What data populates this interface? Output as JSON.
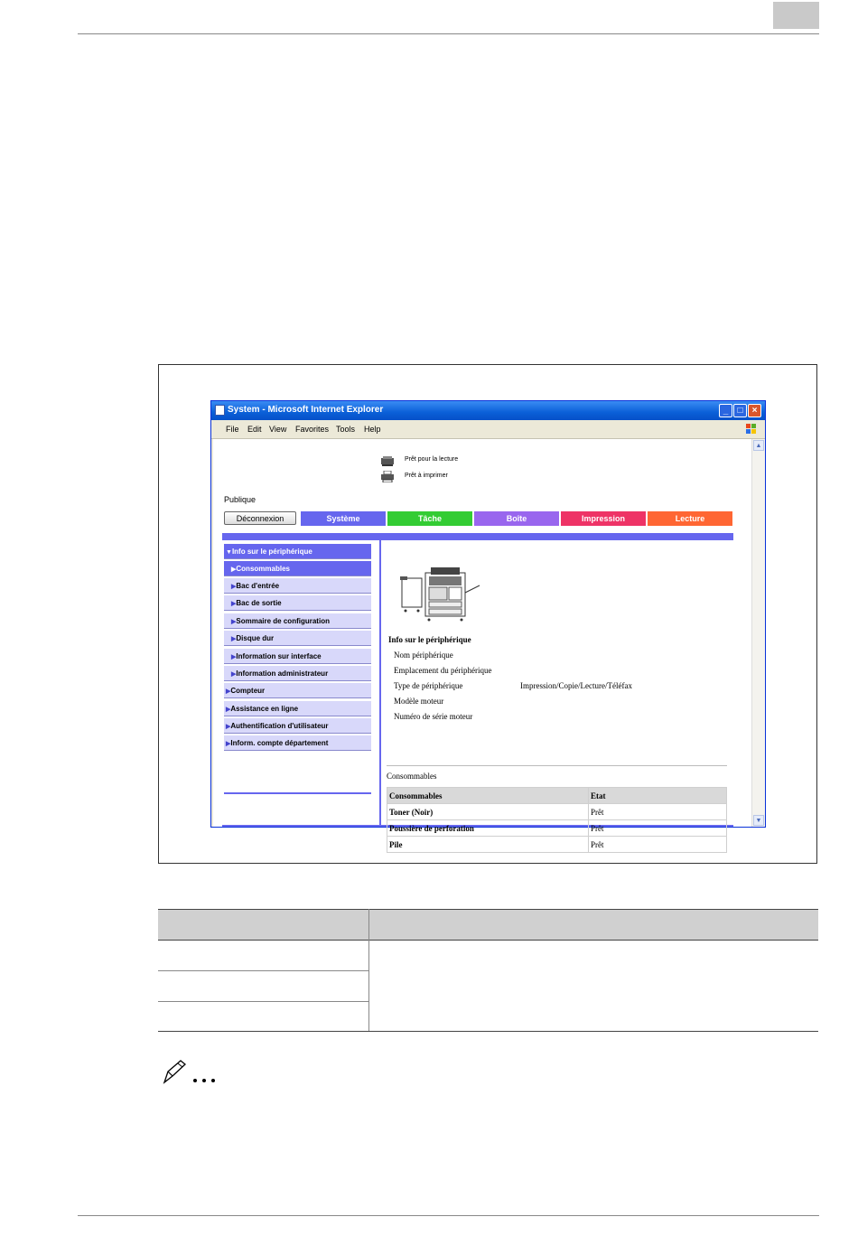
{
  "window": {
    "title": "System - Microsoft Internet Explorer",
    "menu": [
      "File",
      "Edit",
      "View",
      "Favorites",
      "Tools",
      "Help"
    ],
    "controls": [
      "minimize-icon",
      "maximize-icon",
      "close-icon"
    ]
  },
  "status": {
    "line1": "Prêt pour la lecture",
    "line2": "Prêt à imprimer"
  },
  "mode_label": "Publique",
  "logout_label": "Déconnexion",
  "tabs": [
    {
      "label": "Système",
      "color": "#6666ee"
    },
    {
      "label": "Tâche",
      "color": "#33cc33"
    },
    {
      "label": "Boîte",
      "color": "#9966ee"
    },
    {
      "label": "Impression",
      "color": "#ee3366"
    },
    {
      "label": "Lecture",
      "color": "#ff6633"
    }
  ],
  "sidebar": [
    {
      "label": "Info sur le périphérique",
      "marker": "▼"
    },
    {
      "label": "Consommables",
      "marker": "▶"
    },
    {
      "label": "Bac d'entrée",
      "marker": "▶"
    },
    {
      "label": "Bac de sortie",
      "marker": "▶"
    },
    {
      "label": "Sommaire de configuration",
      "marker": "▶"
    },
    {
      "label": "Disque dur",
      "marker": "▶"
    },
    {
      "label": "Information sur interface",
      "marker": "▶"
    },
    {
      "label": "Information administrateur",
      "marker": "▶"
    },
    {
      "label": "Compteur",
      "marker": "▶"
    },
    {
      "label": "Assistance en ligne",
      "marker": "▶"
    },
    {
      "label": "Authentification d'utilisateur",
      "marker": "▶"
    },
    {
      "label": "Inform. compte département",
      "marker": "▶"
    }
  ],
  "device_info": {
    "heading": "Info sur le périphérique",
    "rows": [
      {
        "label": "Nom périphérique",
        "value": ""
      },
      {
        "label": "Emplacement du périphérique",
        "value": ""
      },
      {
        "label": "Type de périphérique",
        "value": "Impression/Copie/Lecture/Téléfax"
      },
      {
        "label": "Modèle moteur",
        "value": ""
      },
      {
        "label": "Numéro de série moteur",
        "value": ""
      }
    ]
  },
  "consumables": {
    "heading": "Consommables",
    "columns": [
      "Consommables",
      "Etat"
    ],
    "rows": [
      [
        "Toner (Noir)",
        "Prêt"
      ],
      [
        "Poussière de perforation",
        "Prêt"
      ],
      [
        "Pile",
        "Prêt"
      ]
    ]
  },
  "note_icon": "pencil-note-icon"
}
